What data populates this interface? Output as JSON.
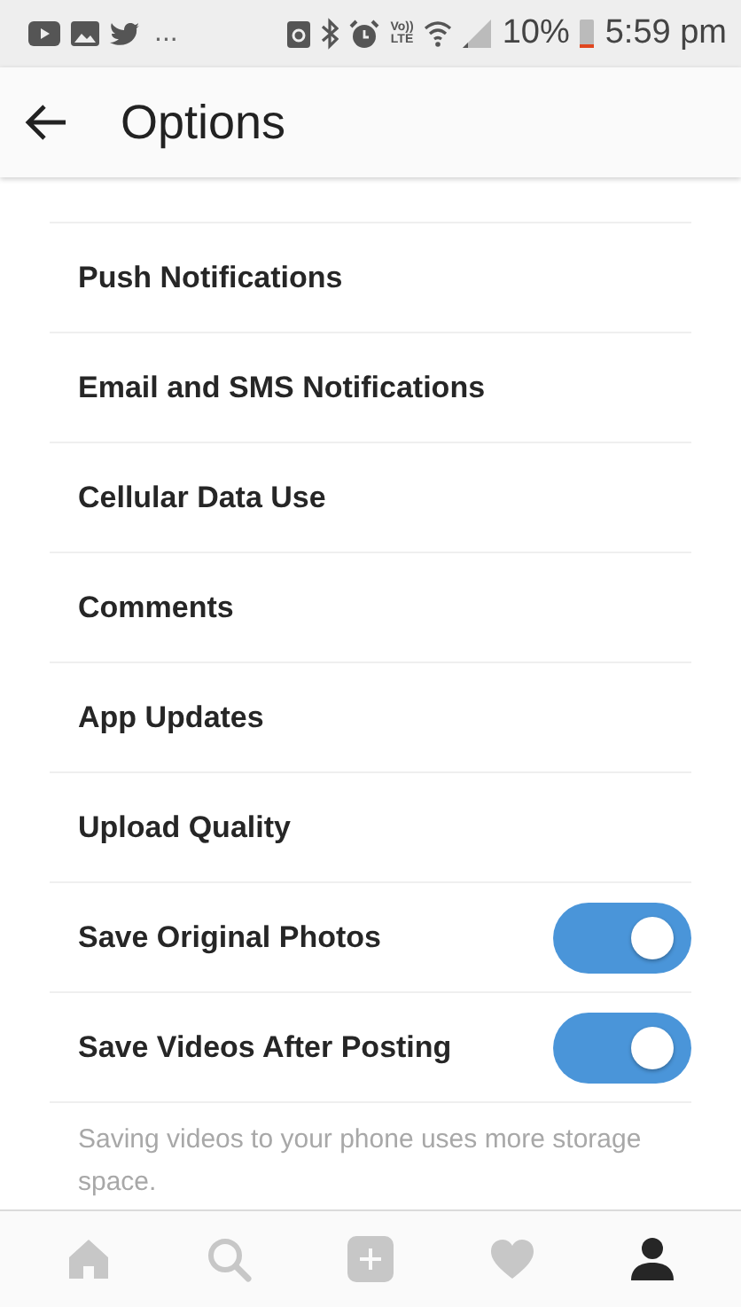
{
  "status_bar": {
    "overflow": "...",
    "volte": [
      "Vo))",
      "LTE"
    ],
    "battery_percent": "10%",
    "time": "5:59 pm"
  },
  "header": {
    "title": "Options"
  },
  "settings": [
    {
      "kind": "link",
      "label": "Push Notifications"
    },
    {
      "kind": "link",
      "label": "Email and SMS Notifications"
    },
    {
      "kind": "link",
      "label": "Cellular Data Use"
    },
    {
      "kind": "link",
      "label": "Comments"
    },
    {
      "kind": "link",
      "label": "App Updates"
    },
    {
      "kind": "link",
      "label": "Upload Quality"
    },
    {
      "kind": "toggle",
      "label": "Save Original Photos",
      "on": true
    },
    {
      "kind": "toggle",
      "label": "Save Videos After Posting",
      "on": true
    }
  ],
  "note": "Saving videos to your phone uses more storage space.",
  "bottom_nav": [
    {
      "kind": "home",
      "selected": false
    },
    {
      "kind": "search",
      "selected": false
    },
    {
      "kind": "add",
      "selected": false
    },
    {
      "kind": "heart",
      "selected": false
    },
    {
      "kind": "profile",
      "selected": true
    }
  ]
}
